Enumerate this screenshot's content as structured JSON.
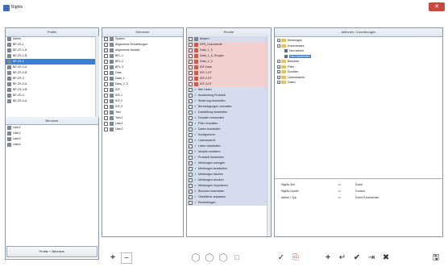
{
  "window": {
    "title": "Rights",
    "close_label": "✕"
  },
  "profiles_panel": {
    "header": "Profile",
    "items": [
      "Admin",
      "BP-ZS-1",
      "BP-ZS-1-A",
      "BP-ZS-1-B",
      "BP-ZS-2",
      "BP-ZS-2-A",
      "BP-ZS-2-B",
      "BP-ZS-3",
      "BP-ZS-3-A",
      "BP-ZS-3-B",
      "BP-ZS-4",
      "BP-ZS-4-A"
    ],
    "selected_index": 4,
    "users_header": "Benutzer",
    "users": [
      "User1",
      "User2",
      "User3",
      "User4"
    ],
    "footer_button": "Profile + Benutzer"
  },
  "elements_panel": {
    "header": "Elemente",
    "items": [
      "System",
      "Allgemeine Einstellungen",
      "Allgemeine Ansicht",
      "BPL-1",
      "BPL-2",
      "BPL-3",
      "Data",
      "Data_1",
      "Data_2_3",
      "IDF",
      "IDF-1",
      "IDF-2",
      "IDF-3",
      "Test",
      "Test-1",
      "User1",
      "User2"
    ]
  },
  "rights_panel": {
    "header": "Rechte",
    "items": [
      {
        "label": "Ändern",
        "kind": "blue"
      },
      {
        "label": "DPS_Dokumente",
        "kind": "red"
      },
      {
        "label": "Data_1_3",
        "kind": "red"
      },
      {
        "label": "Data_1_4_Gruppe",
        "kind": "red"
      },
      {
        "label": "Data_2_3",
        "kind": "red"
      },
      {
        "label": "IDF-Data",
        "kind": "red"
      },
      {
        "label": "IDF-1-DT",
        "kind": "red"
      },
      {
        "label": "IDF-2-DT",
        "kind": "red"
      },
      {
        "label": "IDF-3-DT",
        "kind": "red"
      },
      {
        "label": "Alle Listen",
        "kind": "check"
      },
      {
        "label": "Auswertung Protokoll",
        "kind": "check"
      },
      {
        "label": "Änderung bearbeiten",
        "kind": "check"
      },
      {
        "label": "Berechtigungen verwalten",
        "kind": "check"
      },
      {
        "label": "Darstellung bearbeiten",
        "kind": "check"
      },
      {
        "label": "Drucken verwenden",
        "kind": "check"
      },
      {
        "label": "Filter verwalten",
        "kind": "check"
      },
      {
        "label": "Daten bearbeiten",
        "kind": "check"
      },
      {
        "label": "Konfigurieren",
        "kind": "check"
      },
      {
        "label": "Listenansicht",
        "kind": "check"
      },
      {
        "label": "Listen bearbeiten",
        "kind": "check"
      },
      {
        "label": "Module erweitern",
        "kind": "check"
      },
      {
        "label": "Protokoll bearbeiten",
        "kind": "check"
      },
      {
        "label": "Meldungen anzeigen",
        "kind": "check"
      },
      {
        "label": "Meldungen bearbeiten",
        "kind": "check"
      },
      {
        "label": "Meldungen löschen",
        "kind": "check"
      },
      {
        "label": "Meldungen drucken",
        "kind": "check"
      },
      {
        "label": "Meldungen exportieren",
        "kind": "check"
      },
      {
        "label": "Benutzer bearbeiten",
        "kind": "check"
      },
      {
        "label": "Oberfläche anpassen",
        "kind": "check"
      },
      {
        "label": "Einstellungen",
        "kind": "check"
      }
    ]
  },
  "actions_panel": {
    "header": "Aktionen / Zuordnungen",
    "tree": [
      {
        "label": "Meldungen",
        "level": 0,
        "box": "+"
      },
      {
        "label": "Kommentare",
        "level": 0,
        "box": "-"
      },
      {
        "label": "Neu setzen",
        "level": 1,
        "box": ""
      },
      {
        "label": "Neu bearbeiten",
        "level": 1,
        "box": "",
        "selected": true
      },
      {
        "label": "Benutzer",
        "level": 0,
        "box": "+"
      },
      {
        "label": "Filter",
        "level": 0,
        "box": "+"
      },
      {
        "label": "Drucken",
        "level": 0,
        "box": "+"
      },
      {
        "label": "Listenansicht",
        "level": 0,
        "box": "+"
      },
      {
        "label": "Daten",
        "level": 0,
        "box": "+"
      }
    ],
    "mapping": [
      {
        "left": "Rights Ziel",
        "arrow": "=>",
        "right": "Event"
      },
      {
        "left": "Rights Quelle",
        "arrow": "=>",
        "right": "Control"
      },
      {
        "left": "Aktion / Typ",
        "arrow": "=>",
        "right": "Event Kommentar"
      }
    ]
  },
  "toolbar": {
    "add_label": "+",
    "remove_label": "−",
    "circle_icons": [
      "◯",
      "◯",
      "◯",
      "□"
    ],
    "action_icons": [
      "✓",
      "⎘",
      "+",
      "↵",
      "✔",
      "⇥",
      "✖",
      "🖫"
    ]
  }
}
